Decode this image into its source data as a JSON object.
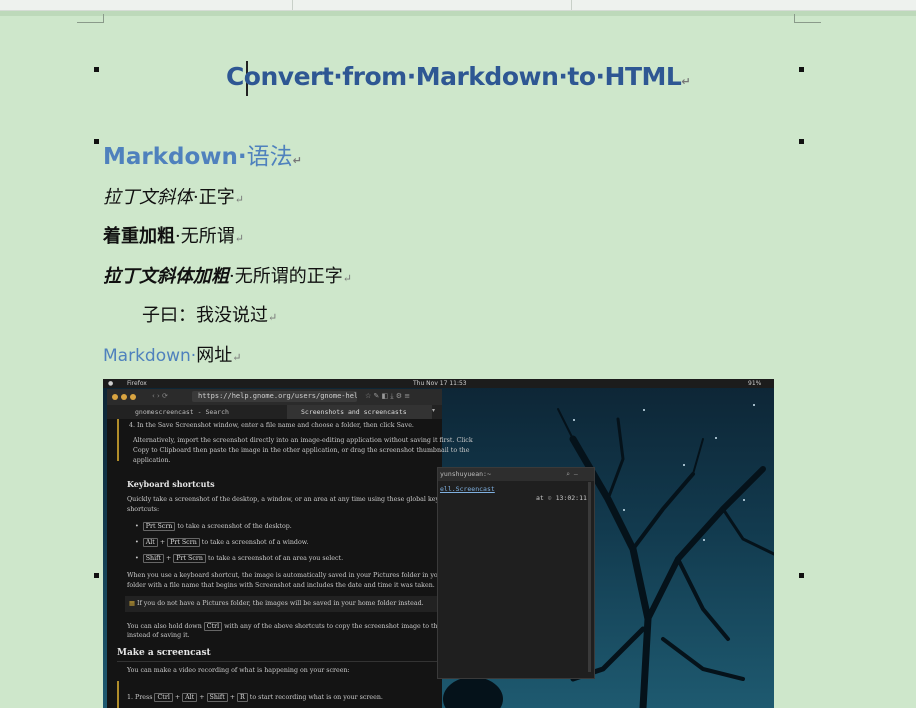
{
  "document": {
    "title": "Convert·from·Markdown·to·HTML",
    "heading_latin": "Markdown·",
    "heading_cjk": "语法",
    "line1_italic": "拉丁文斜体",
    "line1_rest": "·正字",
    "line2_bold": "着重加粗",
    "line2_rest": "·无所谓",
    "line3_bolditalic": "拉丁文斜体加粗",
    "line3_rest": "·无所谓的正字",
    "quote": "子曰：我没说过",
    "link_text": "Markdown·",
    "link_rest": "网址",
    "para_mark": "↵"
  },
  "screenshot": {
    "topbar": {
      "app": "Firefox",
      "clock": "Thu Nov 17 11:53",
      "battery": "91%"
    },
    "browser": {
      "url": "https://help.gnome.org/users/gnome-help/stable",
      "tabs": [
        "gnomescreencast - Search",
        "Screenshots and screencasts"
      ],
      "body": {
        "step4": "4. In the Save Screenshot window, enter a file name and choose a folder, then click Save.",
        "alt1": "Alternatively, import the screenshot directly into an image-editing application without saving it first. Click",
        "alt2": "Copy to Clipboard then paste the image in the other application, or drag the screenshot thumbnail to the",
        "alt3": "application.",
        "kb_heading": "Keyboard shortcuts",
        "kb_intro1": "Quickly take a screenshot of the desktop, a window, or an area at any time using these global keyboard",
        "kb_intro2": "shortcuts:",
        "key_prtscn": "Prt Scrn",
        "key_alt": "Alt",
        "key_shift": "Shift",
        "key_ctrl": "Ctrl",
        "key_r": "R",
        "b1": "to take a screenshot of the desktop.",
        "b2": "to take a screenshot of a window.",
        "b3": "to take a screenshot of an area you select.",
        "auto1": "When you use a keyboard shortcut, the image is automatically saved in your Pictures folder in your home",
        "auto2": "folder with a file name that begins with Screenshot and includes the date and time it was taken.",
        "note": "If you do not have a Pictures folder, the images will be saved in your home folder instead.",
        "ctrl1": "You can also hold down",
        "ctrl2": "with any of the above shortcuts to copy the screenshot image to the clipboard",
        "ctrl3": "instead of saving it.",
        "sc_heading": "Make a screencast",
        "sc_intro": "You can make a video recording of what is happening on your screen:",
        "step1a": "1. Press",
        "step1b": "to start recording what is on your screen."
      }
    },
    "terminal": {
      "title": "yunshuyuean:~",
      "line1": "ell.Screencast",
      "prompt": "at",
      "time": "13:02:11"
    }
  }
}
